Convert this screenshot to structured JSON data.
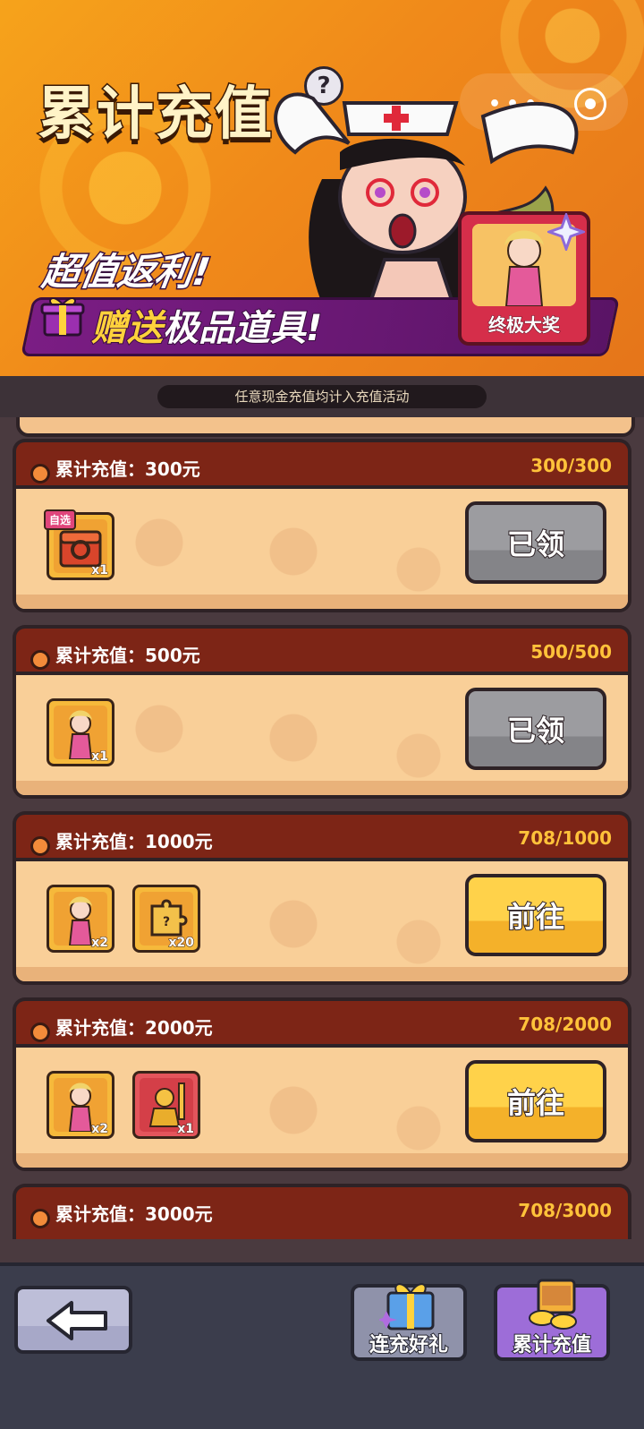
{
  "banner": {
    "title": "累计充值",
    "help_symbol": "?",
    "promo_line1": "超值返利!",
    "promo_line2_highlight": "赠送",
    "promo_line2_rest": "极品道具!",
    "grand_prize_label": "终极大奖",
    "capsule_menu": "•••"
  },
  "notice": "任意现金充值均计入充值活动",
  "tiers": [
    {
      "title": "累计充值：300元",
      "progress": "300/300",
      "button": "已领",
      "state": "claimed",
      "rewards": [
        {
          "icon": "treasure-chest-icon",
          "qty": "x1",
          "tag": "自选"
        }
      ]
    },
    {
      "title": "累计充值：500元",
      "progress": "500/500",
      "button": "已领",
      "state": "claimed",
      "rewards": [
        {
          "icon": "hero-portrait-icon",
          "qty": "x1"
        }
      ]
    },
    {
      "title": "累计充值：1000元",
      "progress": "708/1000",
      "button": "前往",
      "state": "go",
      "rewards": [
        {
          "icon": "hero-portrait-icon",
          "qty": "x2"
        },
        {
          "icon": "puzzle-piece-icon",
          "qty": "x20"
        }
      ]
    },
    {
      "title": "累计充值：2000元",
      "progress": "708/2000",
      "button": "前往",
      "state": "go",
      "rewards": [
        {
          "icon": "hero-portrait-icon",
          "qty": "x2"
        },
        {
          "icon": "golden-statue-icon",
          "qty": "x1"
        }
      ]
    },
    {
      "title": "累计充值：3000元",
      "progress": "708/3000"
    }
  ],
  "bottom": {
    "tabs": [
      {
        "label": "连充好礼",
        "icon": "gift-box-icon"
      },
      {
        "label": "累计充值",
        "icon": "gold-chest-icon"
      }
    ]
  },
  "colors": {
    "accent_gold": "#ffc23a",
    "card_header": "#7d2516",
    "card_body": "#f9cf98",
    "button_claimed": "#9c9ca0",
    "button_go": "#ffd24a",
    "active_tab": "#9d6dd8"
  }
}
